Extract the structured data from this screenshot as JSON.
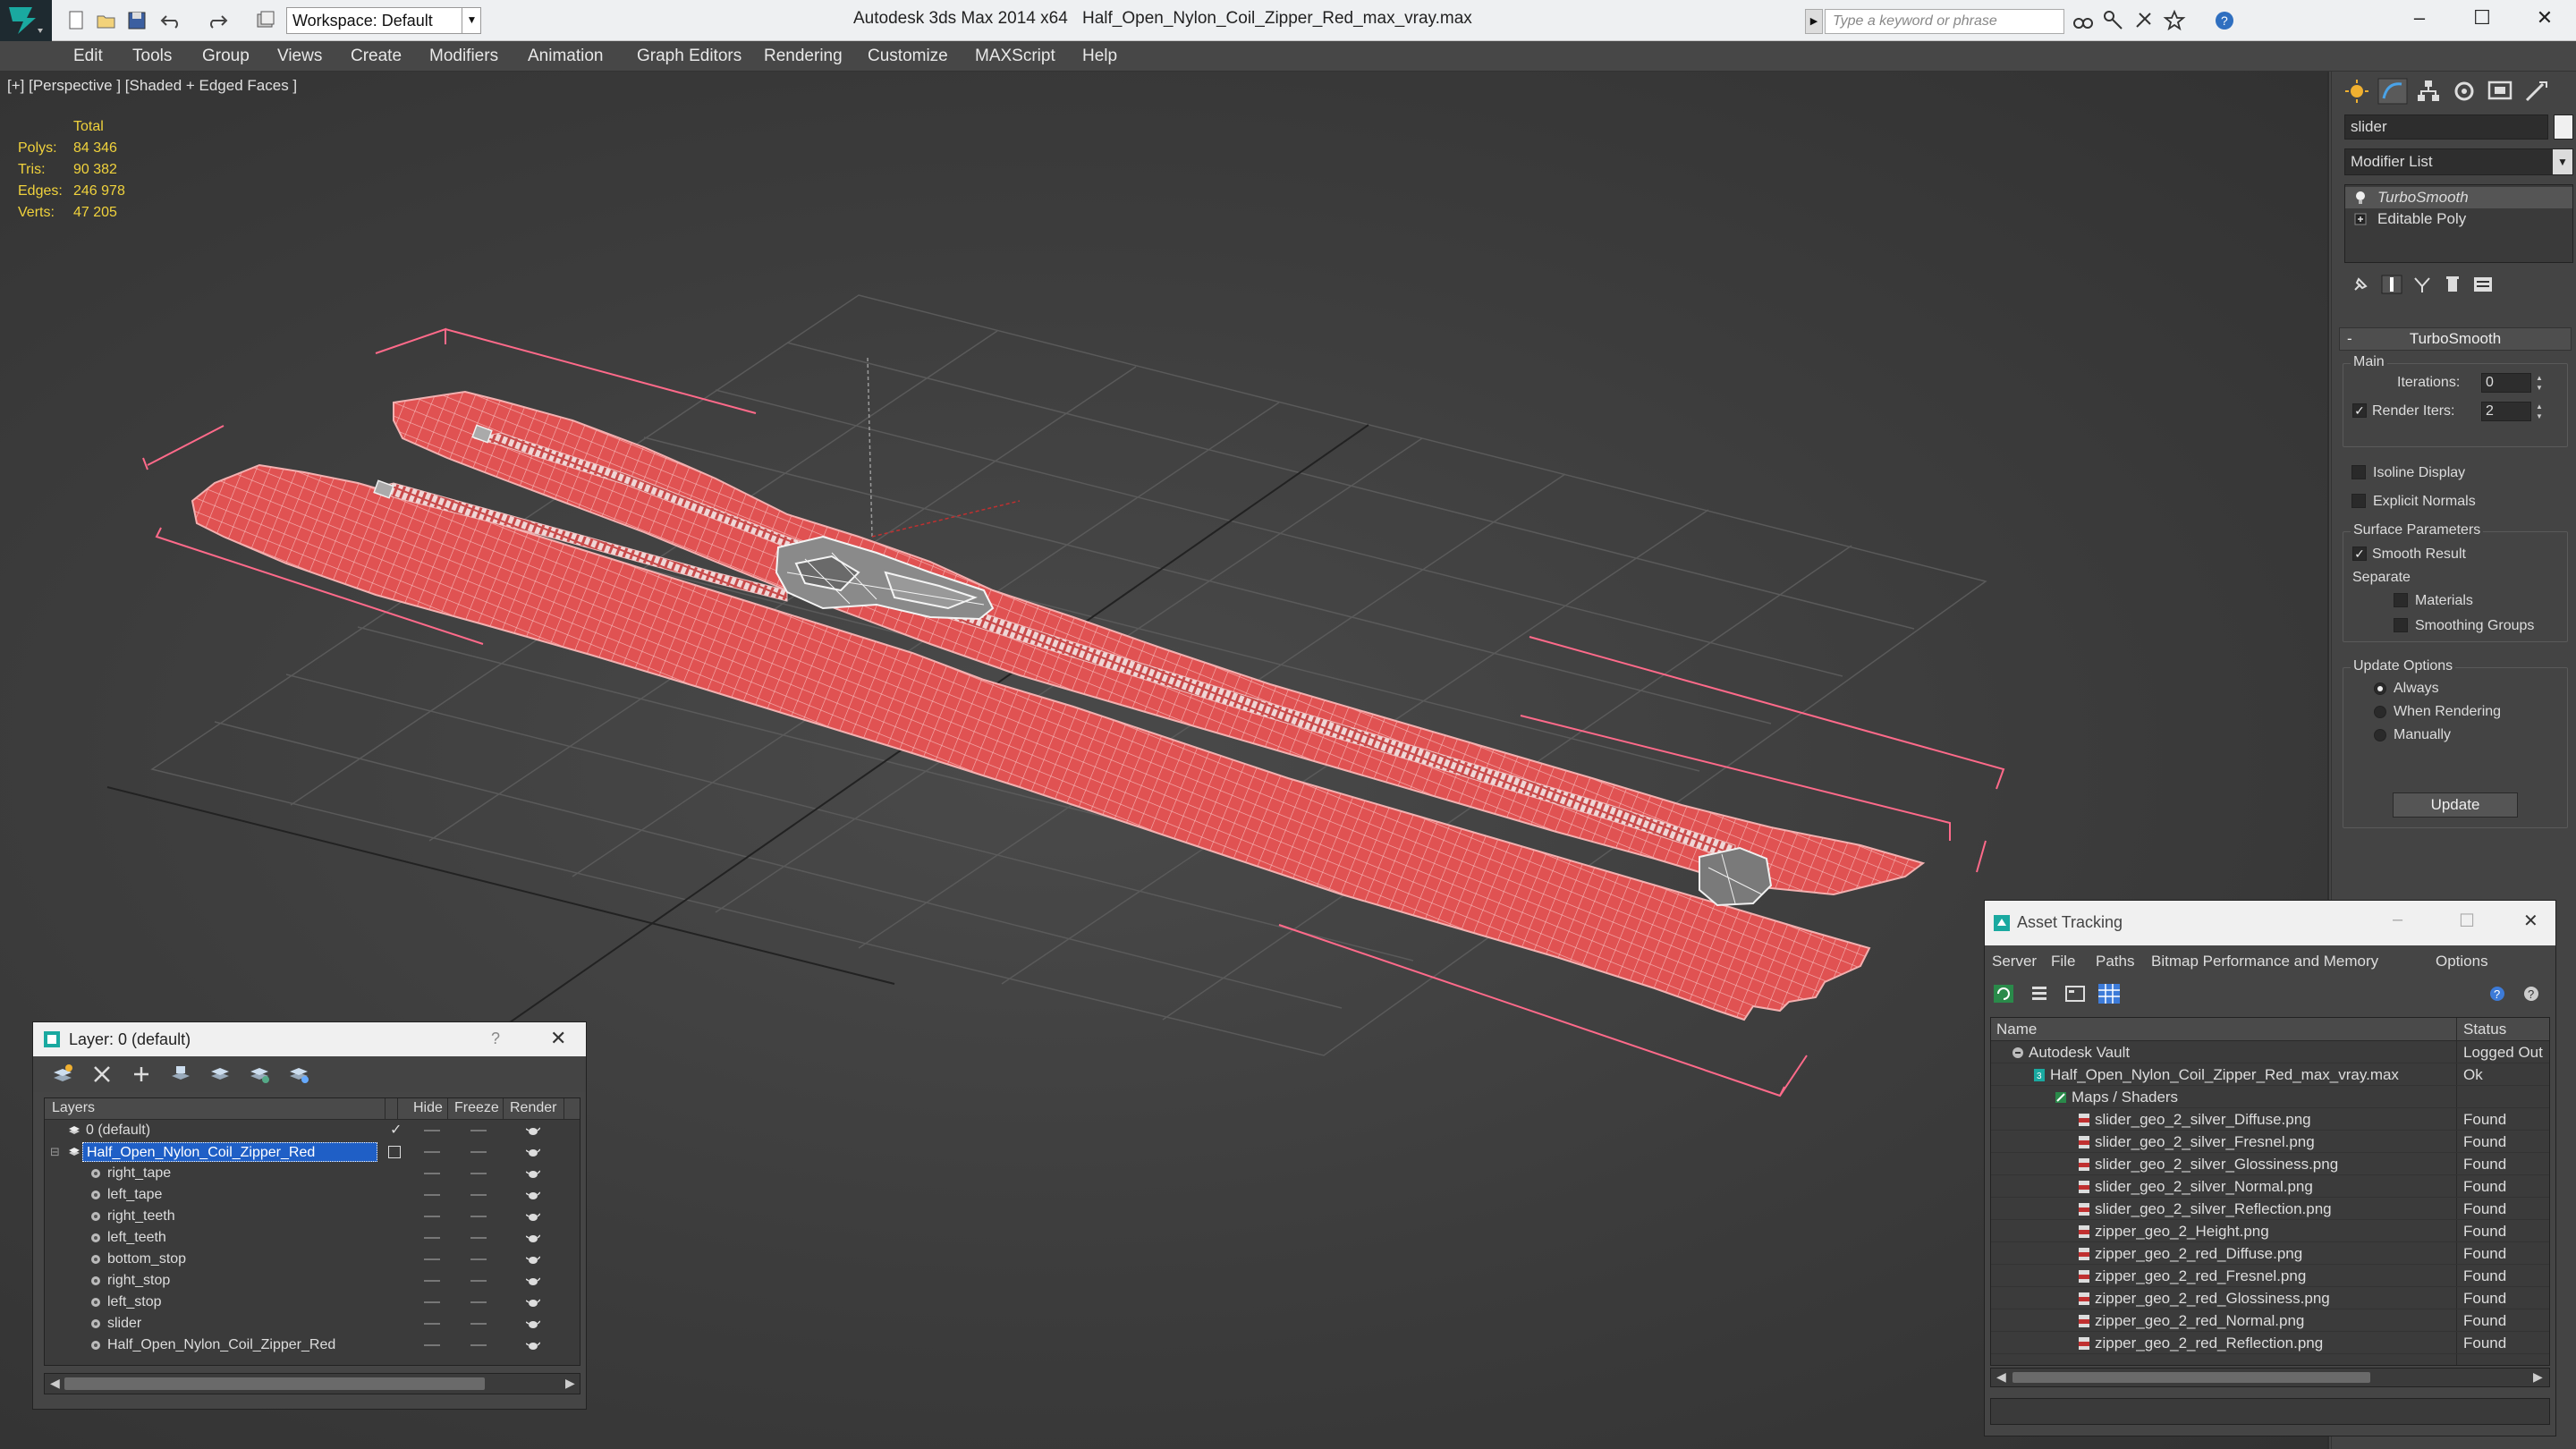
{
  "titlebar": {
    "workspace": "Workspace: Default",
    "app_title": "Autodesk 3ds Max  2014 x64",
    "file_title": "Half_Open_Nylon_Coil_Zipper_Red_max_vray.max",
    "search_placeholder": "Type a keyword or phrase"
  },
  "menu": [
    "Edit",
    "Tools",
    "Group",
    "Views",
    "Create",
    "Modifiers",
    "Animation",
    "Graph Editors",
    "Rendering",
    "Customize",
    "MAXScript",
    "Help"
  ],
  "viewport": {
    "label": "[+] [Perspective ] [Shaded + Edged Faces ]",
    "stats": {
      "header": "Total",
      "polys_label": "Polys:",
      "polys": "84 346",
      "tris_label": "Tris:",
      "tris": "90 382",
      "edges_label": "Edges:",
      "edges": "246 978",
      "verts_label": "Verts:",
      "verts": "47 205"
    }
  },
  "command_panel": {
    "object_name": "slider",
    "modifier_list": "Modifier List",
    "stack": [
      "TurboSmooth",
      "Editable Poly"
    ],
    "rollout_title": "TurboSmooth",
    "main_group": "Main",
    "iterations_label": "Iterations:",
    "iterations": "0",
    "render_iters_label": "Render Iters:",
    "render_iters": "2",
    "isoline_label": "Isoline Display",
    "explicit_normals_label": "Explicit Normals",
    "surface_group": "Surface Parameters",
    "smooth_result_label": "Smooth Result",
    "separate_label": "Separate",
    "materials_label": "Materials",
    "smoothing_groups_label": "Smoothing Groups",
    "update_group": "Update Options",
    "always_label": "Always",
    "when_rendering_label": "When Rendering",
    "manually_label": "Manually",
    "update_button": "Update"
  },
  "layer_dialog": {
    "title": "Layer: 0 (default)",
    "help": "?",
    "columns": {
      "layers": "Layers",
      "hide": "Hide",
      "freeze": "Freeze",
      "render": "Render"
    },
    "rows": [
      {
        "name": "0 (default)"
      },
      {
        "name": "Half_Open_Nylon_Coil_Zipper_Red"
      },
      {
        "name": "right_tape"
      },
      {
        "name": "left_tape"
      },
      {
        "name": "right_teeth"
      },
      {
        "name": "left_teeth"
      },
      {
        "name": "bottom_stop"
      },
      {
        "name": "right_stop"
      },
      {
        "name": "left_stop"
      },
      {
        "name": "slider"
      },
      {
        "name": "Half_Open_Nylon_Coil_Zipper_Red"
      }
    ]
  },
  "asset_tracking": {
    "title": "Asset Tracking",
    "menu": [
      "Server",
      "File",
      "Paths",
      "Bitmap Performance and Memory",
      "Options"
    ],
    "columns": {
      "name": "Name",
      "status": "Status"
    },
    "rows": [
      {
        "name": "Autodesk Vault",
        "status": "Logged Out"
      },
      {
        "name": "Half_Open_Nylon_Coil_Zipper_Red_max_vray.max",
        "status": "Ok"
      },
      {
        "name": "Maps / Shaders",
        "status": ""
      },
      {
        "name": "slider_geo_2_silver_Diffuse.png",
        "status": "Found"
      },
      {
        "name": "slider_geo_2_silver_Fresnel.png",
        "status": "Found"
      },
      {
        "name": "slider_geo_2_silver_Glossiness.png",
        "status": "Found"
      },
      {
        "name": "slider_geo_2_silver_Normal.png",
        "status": "Found"
      },
      {
        "name": "slider_geo_2_silver_Reflection.png",
        "status": "Found"
      },
      {
        "name": "zipper_geo_2_Height.png",
        "status": "Found"
      },
      {
        "name": "zipper_geo_2_red_Diffuse.png",
        "status": "Found"
      },
      {
        "name": "zipper_geo_2_red_Fresnel.png",
        "status": "Found"
      },
      {
        "name": "zipper_geo_2_red_Glossiness.png",
        "status": "Found"
      },
      {
        "name": "zipper_geo_2_red_Normal.png",
        "status": "Found"
      },
      {
        "name": "zipper_geo_2_red_Reflection.png",
        "status": "Found"
      }
    ]
  },
  "colors": {
    "stats": "#f0d23c",
    "mesh_fill": "#e05050",
    "selection_bbox": "#ff6a8a",
    "layer_selected": "#1f5fc6"
  }
}
